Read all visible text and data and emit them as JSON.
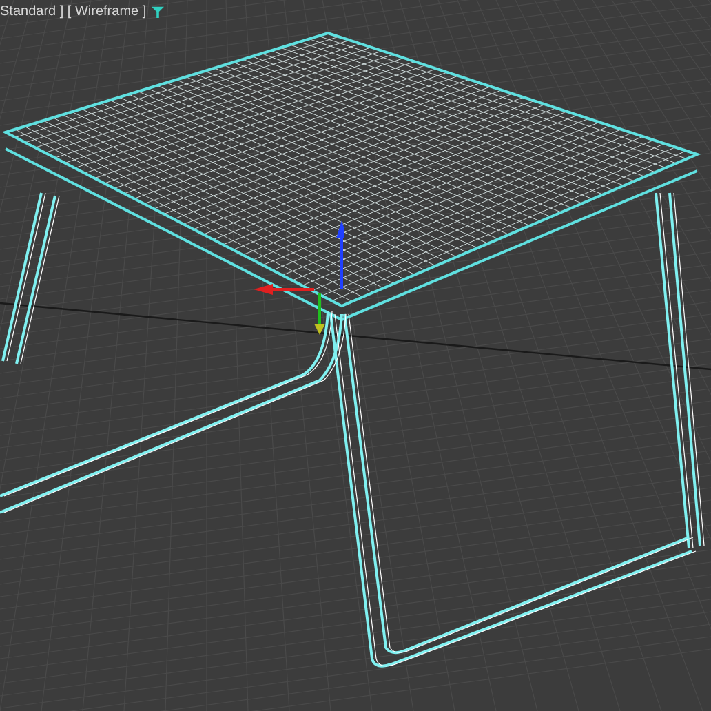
{
  "viewport": {
    "label": "Standard ] [ Wireframe ]"
  }
}
